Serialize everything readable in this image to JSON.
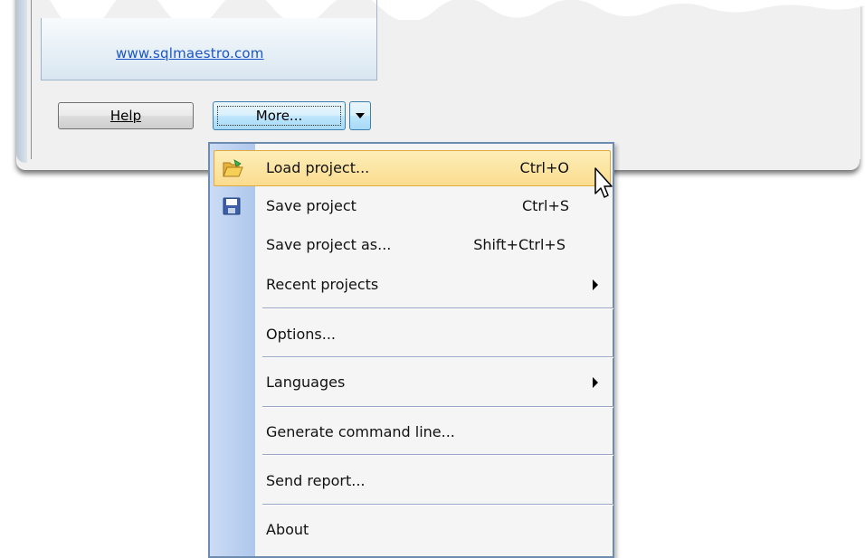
{
  "window": {
    "link_text": "www.sqlmaestro.com"
  },
  "buttons": {
    "help": "Help",
    "more": "More..."
  },
  "menu": {
    "items": [
      {
        "label": "Load project...",
        "shortcut": "Ctrl+O",
        "icon": "folder-open-icon",
        "highlighted": true
      },
      {
        "label": "Save project",
        "shortcut": "Ctrl+S",
        "icon": "save-icon"
      },
      {
        "label": "Save project as...",
        "shortcut": "Shift+Ctrl+S"
      },
      {
        "label": "Recent projects",
        "submenu": true
      },
      {
        "label": "Options..."
      },
      {
        "label": "Languages",
        "submenu": true
      },
      {
        "label": "Generate command line..."
      },
      {
        "label": "Send report..."
      },
      {
        "label": "About"
      }
    ]
  },
  "colors": {
    "menu_highlight": "#fbdc8f",
    "menu_border": "#6e8bb0",
    "gutter": "#aec7ec",
    "link": "#1a55c4"
  }
}
